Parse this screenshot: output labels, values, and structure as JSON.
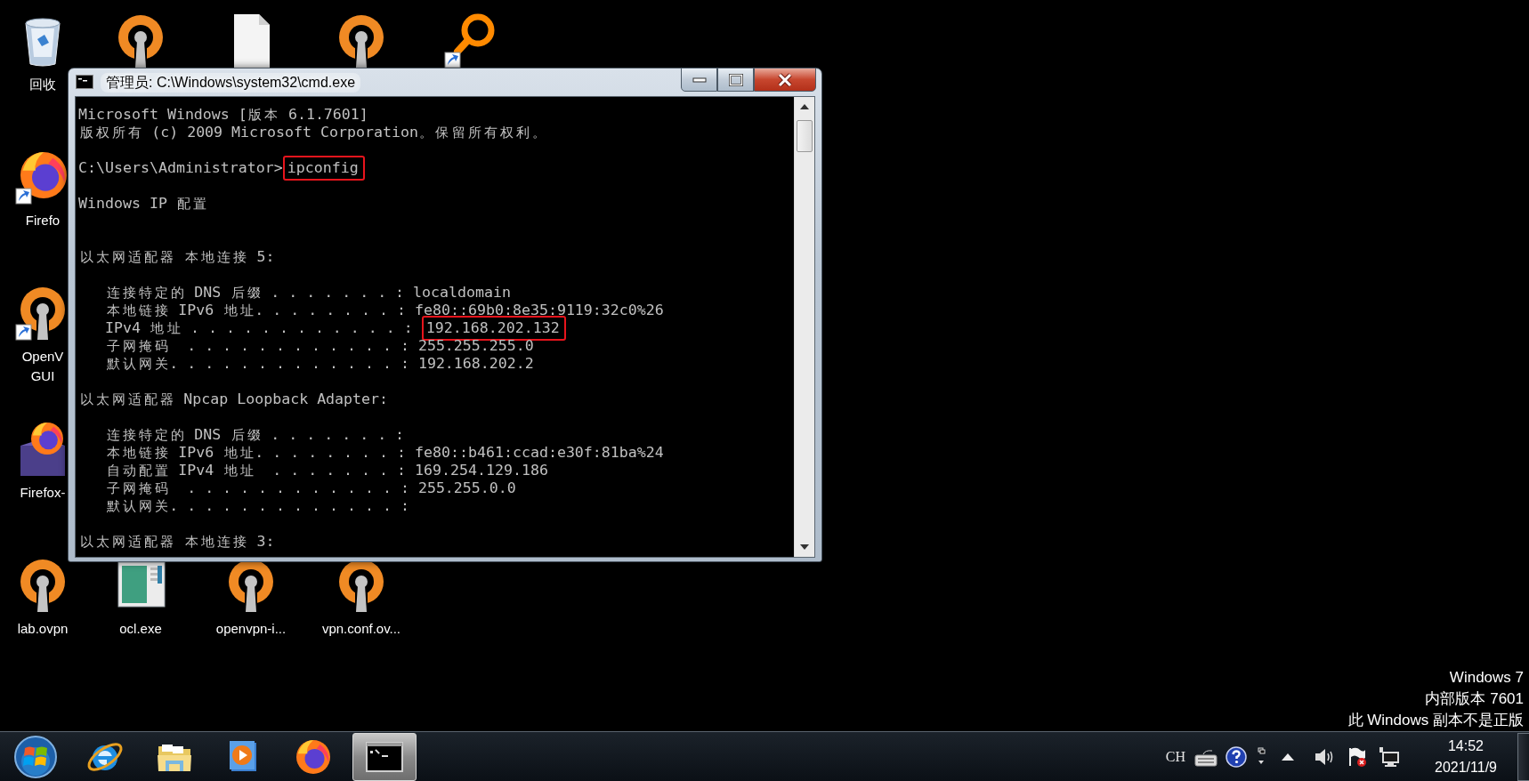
{
  "desktop": {
    "top_row": [
      {
        "kind": "recycle-bin",
        "shortcut": false,
        "label_lines": [
          "回收"
        ]
      },
      {
        "kind": "openvpn",
        "shortcut": false
      },
      {
        "kind": "file",
        "shortcut": false
      },
      {
        "kind": "openvpn",
        "shortcut": false
      },
      {
        "kind": "search",
        "shortcut": true
      }
    ],
    "left_column": [
      {
        "kind": "firefox",
        "shortcut": true,
        "label_lines": [
          "Firefo"
        ]
      },
      {
        "kind": "openvpn",
        "shortcut": true,
        "label_lines": [
          "OpenV",
          "GUI"
        ]
      },
      {
        "kind": "firefox-portable",
        "shortcut": false,
        "label_lines": [
          "Firefox-"
        ]
      }
    ],
    "bottom_row": [
      {
        "kind": "openvpn",
        "shortcut": false,
        "label_lines": [
          "lab.ovpn"
        ]
      },
      {
        "kind": "ocl",
        "shortcut": false,
        "label_lines": [
          "ocl.exe"
        ]
      },
      {
        "kind": "openvpn",
        "shortcut": false,
        "label_lines": [
          "openvpn-i..."
        ]
      },
      {
        "kind": "openvpn",
        "shortcut": false,
        "label_lines": [
          "vpn.conf.ov..."
        ]
      }
    ],
    "notice": [
      "Windows 7",
      "内部版本 7601",
      "此 Windows 副本不是正版"
    ]
  },
  "window": {
    "title": "管理员: C:\\Windows\\system32\\cmd.exe",
    "lines": [
      {
        "kind": "text",
        "text": "Microsoft Windows [版本 6.1.7601]"
      },
      {
        "kind": "text",
        "text": "版权所有 (c) 2009 Microsoft Corporation。保留所有权利。"
      },
      {
        "kind": "blank"
      },
      {
        "kind": "boxed",
        "text": "C:\\Users\\Administrator>",
        "boxed_text": "ipconfig"
      },
      {
        "kind": "blank"
      },
      {
        "kind": "text",
        "text": "Windows IP 配置"
      },
      {
        "kind": "blank"
      },
      {
        "kind": "blank"
      },
      {
        "kind": "text",
        "text": "以太网适配器 本地连接 5:"
      },
      {
        "kind": "blank"
      },
      {
        "kind": "text",
        "text": "   连接特定的 DNS 后缀 . . . . . . . : localdomain"
      },
      {
        "kind": "text",
        "text": "   本地链接 IPv6 地址. . . . . . . . : fe80::69b0:8e35:9119:32c0%26"
      },
      {
        "kind": "boxed",
        "text": "   IPv4 地址 . . . . . . . . . . . . : ",
        "boxed_text": "192.168.202.132"
      },
      {
        "kind": "text",
        "text": "   子网掩码  . . . . . . . . . . . . : 255.255.255.0"
      },
      {
        "kind": "text",
        "text": "   默认网关. . . . . . . . . . . . . : 192.168.202.2"
      },
      {
        "kind": "blank"
      },
      {
        "kind": "text",
        "text": "以太网适配器 Npcap Loopback Adapter:"
      },
      {
        "kind": "blank"
      },
      {
        "kind": "text",
        "text": "   连接特定的 DNS 后缀 . . . . . . . :"
      },
      {
        "kind": "text",
        "text": "   本地链接 IPv6 地址. . . . . . . . : fe80::b461:ccad:e30f:81ba%24"
      },
      {
        "kind": "text",
        "text": "   自动配置 IPv4 地址  . . . . . . . : 169.254.129.186"
      },
      {
        "kind": "text",
        "text": "   子网掩码  . . . . . . . . . . . . : 255.255.0.0"
      },
      {
        "kind": "text",
        "text": "   默认网关. . . . . . . . . . . . . :"
      },
      {
        "kind": "blank"
      },
      {
        "kind": "text",
        "text": "以太网适配器 本地连接 3:"
      }
    ]
  },
  "taskbar": {
    "apps": [
      {
        "kind": "ie",
        "active": false
      },
      {
        "kind": "explorer",
        "active": false
      },
      {
        "kind": "media",
        "active": false
      },
      {
        "kind": "firefox",
        "active": false
      },
      {
        "kind": "cmd",
        "active": true
      }
    ],
    "tray": {
      "language": "CH",
      "icons": [
        {
          "kind": "keyboard"
        },
        {
          "kind": "help"
        },
        {
          "kind": "pen"
        },
        {
          "kind": "show-hidden"
        },
        {
          "kind": "volume"
        },
        {
          "kind": "flag"
        },
        {
          "kind": "network"
        }
      ],
      "time": "14:52",
      "date": "2021/11/9"
    }
  }
}
